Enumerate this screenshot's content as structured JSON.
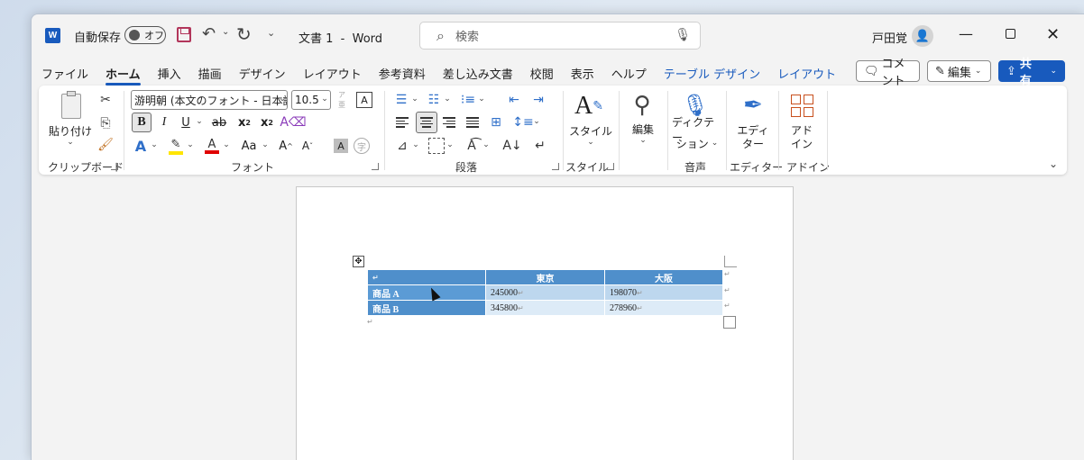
{
  "titlebar": {
    "app_logo": "W",
    "autosave_label": "自動保存",
    "autosave_state": "オフ",
    "doc_title": "文書 1  -  Word",
    "search_placeholder": "検索",
    "user_name": "戸田覚"
  },
  "tabs": [
    {
      "label": "ファイル",
      "active": false,
      "context": false
    },
    {
      "label": "ホーム",
      "active": true,
      "context": false
    },
    {
      "label": "挿入",
      "active": false,
      "context": false
    },
    {
      "label": "描画",
      "active": false,
      "context": false
    },
    {
      "label": "デザイン",
      "active": false,
      "context": false
    },
    {
      "label": "レイアウト",
      "active": false,
      "context": false
    },
    {
      "label": "参考資料",
      "active": false,
      "context": false
    },
    {
      "label": "差し込み文書",
      "active": false,
      "context": false
    },
    {
      "label": "校閲",
      "active": false,
      "context": false
    },
    {
      "label": "表示",
      "active": false,
      "context": false
    },
    {
      "label": "ヘルプ",
      "active": false,
      "context": false
    },
    {
      "label": "テーブル デザイン",
      "active": false,
      "context": true
    },
    {
      "label": "レイアウト",
      "active": false,
      "context": true
    }
  ],
  "right_buttons": {
    "comment": "コメント",
    "edit": "編集",
    "share": "共有"
  },
  "ribbon": {
    "clipboard": {
      "paste": "貼り付け",
      "group": "クリップボード"
    },
    "font": {
      "font_name": "游明朝 (本文のフォント - 日本語",
      "font_size": "10.5",
      "group": "フォント"
    },
    "paragraph": {
      "group": "段落"
    },
    "styles": {
      "button": "スタイル",
      "group": "スタイル"
    },
    "editing": {
      "button": "編集"
    },
    "voice": {
      "button_line1": "ディクテー",
      "button_line2": "ション",
      "group": "音声"
    },
    "editor": {
      "button_line1": "エディ",
      "button_line2": "ター",
      "group": "エディター"
    },
    "addins": {
      "button_line1": "アド",
      "button_line2": "イン",
      "group": "アドイン"
    }
  },
  "table": {
    "headers": [
      "",
      "東京",
      "大阪"
    ],
    "rows": [
      {
        "label": "商品 A",
        "tokyo": "245000",
        "osaka": "198070"
      },
      {
        "label": "商品 B",
        "tokyo": "345800",
        "osaka": "278960"
      }
    ]
  },
  "colors": {
    "accent": "#185abd",
    "table_header": "#4f8fcb",
    "table_band1": "#bdd7ee",
    "table_band2": "#ddebf7"
  }
}
